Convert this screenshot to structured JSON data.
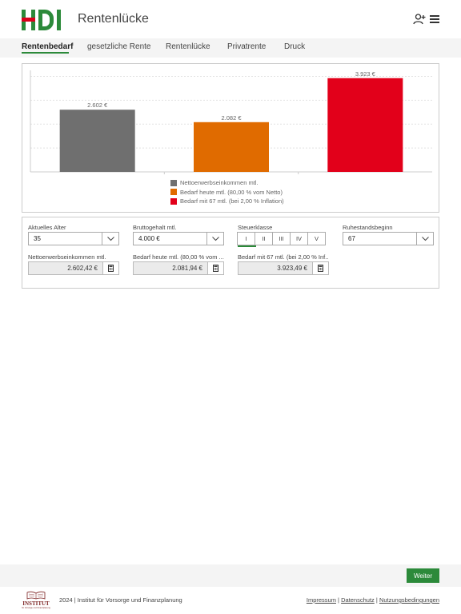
{
  "header": {
    "app_title": "Rentenlücke",
    "logo_text": "HDI",
    "icons": [
      "user-add-icon",
      "menu-icon"
    ]
  },
  "nav": {
    "tabs": [
      {
        "label": "Rentenbedarf",
        "active": true
      },
      {
        "label": "gesetzliche Rente",
        "active": false
      },
      {
        "label": "Rentenlücke",
        "active": false
      },
      {
        "label": "Privatrente",
        "active": false
      },
      {
        "label": "Druck",
        "active": false
      }
    ]
  },
  "chart_data": {
    "type": "bar",
    "categories": [
      "Nettoerwerbseinkommen mtl.",
      "Bedarf heute mtl. (80,00 % vom Netto)",
      "Bedarf mit 67 mtl. (bei 2,00 % Inflation)"
    ],
    "values": [
      2602.42,
      2081.94,
      3923.49
    ],
    "data_labels": [
      "2.602 €",
      "2.082 €",
      "3.923 €"
    ],
    "colors": [
      "#6f6f6f",
      "#e06b00",
      "#e2001a"
    ],
    "ylim": [
      0,
      4250
    ],
    "grid": true,
    "legend_position": "bottom",
    "title": "",
    "xlabel": "",
    "ylabel": ""
  },
  "form": {
    "alter": {
      "label": "Aktuelles Alter",
      "value": "35"
    },
    "brutto": {
      "label": "Bruttogehalt mtl.",
      "value": "4.000 €"
    },
    "steuerklasse": {
      "label": "Steuerklasse",
      "options": [
        "I",
        "II",
        "III",
        "IV",
        "V"
      ],
      "selected": "I"
    },
    "ruhestand": {
      "label": "Ruhestandsbeginn",
      "value": "67"
    },
    "netto": {
      "label": "Nettoerwerbseinkommen mtl.",
      "value": "2.602,42 €"
    },
    "bedarf_heute": {
      "label": "Bedarf heute mtl. (80,00 % vom ...",
      "value": "2.081,94 €"
    },
    "bedarf_67": {
      "label": "Bedarf mit 67 mtl. (bei 2,00 % Inf...",
      "value": "3.923,49 €"
    }
  },
  "actions": {
    "weiter": "Weiter"
  },
  "footer": {
    "logo_text": "INSTITUT",
    "logo_subtext": "für Vorsorge und Finanzplanung",
    "copyright": "2024 | Institut für Vorsorge und Finanzplanung",
    "links": [
      "Impressum",
      "Datenschutz",
      "Nutzungsbedingungen"
    ],
    "separator": "|"
  },
  "colors": {
    "brand_green": "#2c8a3a",
    "brand_red": "#d9001b"
  }
}
